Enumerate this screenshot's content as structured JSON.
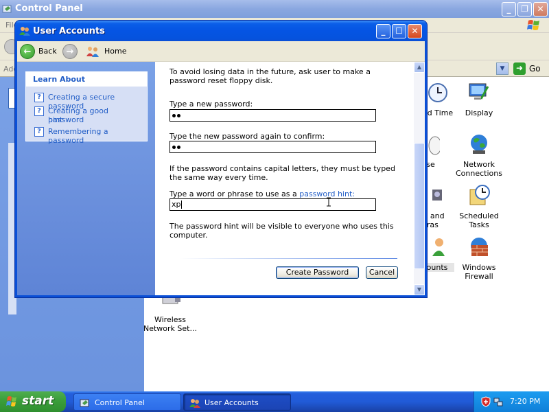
{
  "control_panel": {
    "title": "Control Panel",
    "menu_first": "File",
    "address_label": "Address",
    "go_label": "Go",
    "items": [
      {
        "label": "Date and Time",
        "visible_label": "nd Time"
      },
      {
        "label": "Display"
      },
      {
        "label": "Mouse",
        "visible_label": "use"
      },
      {
        "label": "Network Connections",
        "line1": "Network",
        "line2": "Connections"
      },
      {
        "label": "Scanners and Cameras",
        "line1": "ers and",
        "line2": "eras"
      },
      {
        "label": "Scheduled Tasks",
        "line1": "Scheduled",
        "line2": "Tasks"
      },
      {
        "label": "User Accounts",
        "visible_label": "ccounts"
      },
      {
        "label": "Windows Firewall",
        "line1": "Windows",
        "line2": "Firewall"
      },
      {
        "label": "Wireless Network Setup",
        "line1": "Wireless",
        "line2": "Network Set..."
      }
    ]
  },
  "user_accounts": {
    "title": "User Accounts",
    "toolbar": {
      "back": "Back",
      "home": "Home"
    },
    "learn_about": {
      "header": "Learn About",
      "links": [
        {
          "line1": "Creating a secure password"
        },
        {
          "line1": "Creating a good password",
          "line2": "hint"
        },
        {
          "line1": "Remembering a password"
        }
      ]
    },
    "form": {
      "intro_line1": "To avoid losing data in the future, ask user to make a",
      "intro_line2": "password reset floppy disk.",
      "new_password_label": "Type a new password:",
      "new_password_length": 2,
      "confirm_label": "Type the new password again to confirm:",
      "confirm_length": 2,
      "caps_line1": "If the password contains capital letters, they must be typed",
      "caps_line2": "the same way every time.",
      "hint_label_prefix": "Type a word or phrase to use as a ",
      "hint_label_link": "password hint:",
      "hint_value": "xp",
      "hint_note_line1": "The password hint will be visible to everyone who uses this",
      "hint_note_line2": "computer.",
      "create_button": "Create Password",
      "cancel_button": "Cancel"
    }
  },
  "taskbar": {
    "start": "start",
    "tasks": [
      {
        "label": "Control Panel"
      },
      {
        "label": "User Accounts"
      }
    ],
    "clock": "7:20 PM"
  }
}
